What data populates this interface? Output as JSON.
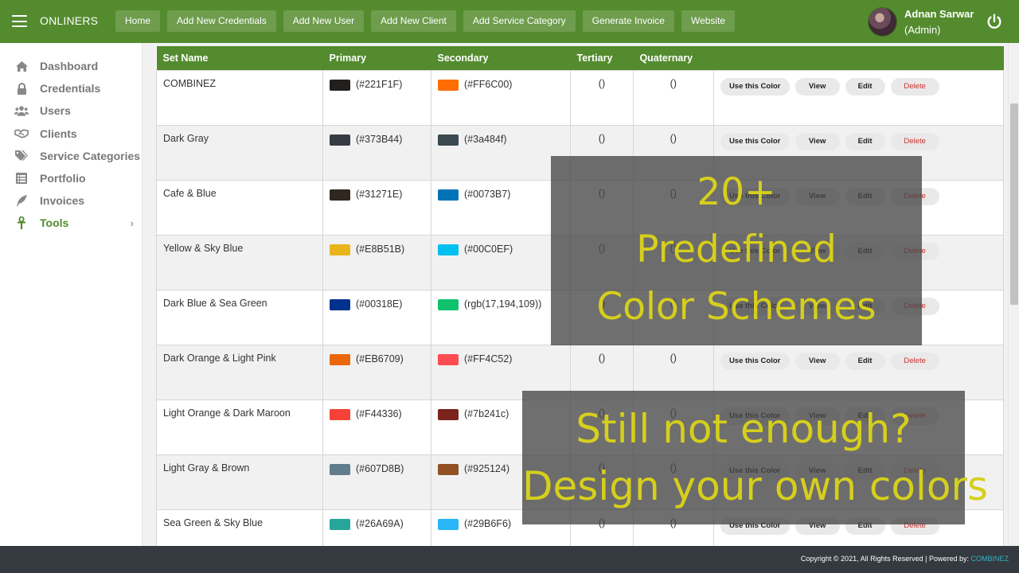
{
  "brand": "ONLINERS",
  "nav": [
    "Home",
    "Add New Credentials",
    "Add New User",
    "Add New Client",
    "Add Service Category",
    "Generate Invoice",
    "Website"
  ],
  "user": {
    "name": "Adnan Sarwar",
    "role": "(Admin)"
  },
  "sidebar": {
    "items": [
      {
        "label": "Dashboard",
        "icon": "home-icon"
      },
      {
        "label": "Credentials",
        "icon": "lock-icon"
      },
      {
        "label": "Users",
        "icon": "users-icon"
      },
      {
        "label": "Clients",
        "icon": "handshake-icon"
      },
      {
        "label": "Service Categories",
        "icon": "tags-icon"
      },
      {
        "label": "Portfolio",
        "icon": "list-icon"
      },
      {
        "label": "Invoices",
        "icon": "feather-icon"
      },
      {
        "label": "Tools",
        "icon": "ankh-icon",
        "active": true,
        "chevron": "›"
      }
    ]
  },
  "table": {
    "headers": [
      "Set Name",
      "Primary",
      "Secondary",
      "Tertiary",
      "Quaternary",
      ""
    ],
    "actions": {
      "use": "Use this Color",
      "view": "View",
      "edit": "Edit",
      "delete": "Delete"
    },
    "rows": [
      {
        "name": "COMBINEZ",
        "primary": "(#221F1F)",
        "primary_color": "#221F1F",
        "secondary": "(#FF6C00)",
        "secondary_color": "#FF6C00",
        "tertiary": "()",
        "quaternary": "()"
      },
      {
        "name": "Dark Gray",
        "primary": "(#373B44)",
        "primary_color": "#373B44",
        "secondary": "(#3a484f)",
        "secondary_color": "#3a484f",
        "tertiary": "()",
        "quaternary": "()"
      },
      {
        "name": "Cafe & Blue",
        "primary": "(#31271E)",
        "primary_color": "#31271E",
        "secondary": "(#0073B7)",
        "secondary_color": "#0073B7",
        "tertiary": "()",
        "quaternary": "()"
      },
      {
        "name": "Yellow & Sky Blue",
        "primary": "(#E8B51B)",
        "primary_color": "#E8B51B",
        "secondary": "(#00C0EF)",
        "secondary_color": "#00C0EF",
        "tertiary": "()",
        "quaternary": "()"
      },
      {
        "name": "Dark Blue & Sea Green",
        "primary": "(#00318E)",
        "primary_color": "#00318E",
        "secondary": "(rgb(17,194,109))",
        "secondary_color": "rgb(17,194,109)",
        "tertiary": "()",
        "quaternary": "()"
      },
      {
        "name": "Dark Orange & Light Pink",
        "primary": "(#EB6709)",
        "primary_color": "#EB6709",
        "secondary": "(#FF4C52)",
        "secondary_color": "#FF4C52",
        "tertiary": "()",
        "quaternary": "()"
      },
      {
        "name": "Light Orange & Dark Maroon",
        "primary": "(#F44336)",
        "primary_color": "#F44336",
        "secondary": "(#7b241c)",
        "secondary_color": "#7b241c",
        "tertiary": "()",
        "quaternary": "()"
      },
      {
        "name": "Light Gray & Brown",
        "primary": "(#607D8B)",
        "primary_color": "#607D8B",
        "secondary": "(#925124)",
        "secondary_color": "#925124",
        "tertiary": "()",
        "quaternary": "()"
      },
      {
        "name": "Sea Green & Sky Blue",
        "primary": "(#26A69A)",
        "primary_color": "#26A69A",
        "secondary": "(#29B6F6)",
        "secondary_color": "#29B6F6",
        "tertiary": "()",
        "quaternary": "()"
      }
    ]
  },
  "overlay1": [
    "20+",
    "Predefined",
    "Color Schemes"
  ],
  "overlay2": [
    "Still not enough?",
    "Design your own colors"
  ],
  "footer": {
    "text": "Copyright © 2021, All Rights Reserved | Powered by: ",
    "brand": "COMBINEZ"
  },
  "colors": {
    "brand_green": "#538b2e",
    "overlay_text": "#d6cf1c",
    "footer_bg": "#343a40"
  }
}
